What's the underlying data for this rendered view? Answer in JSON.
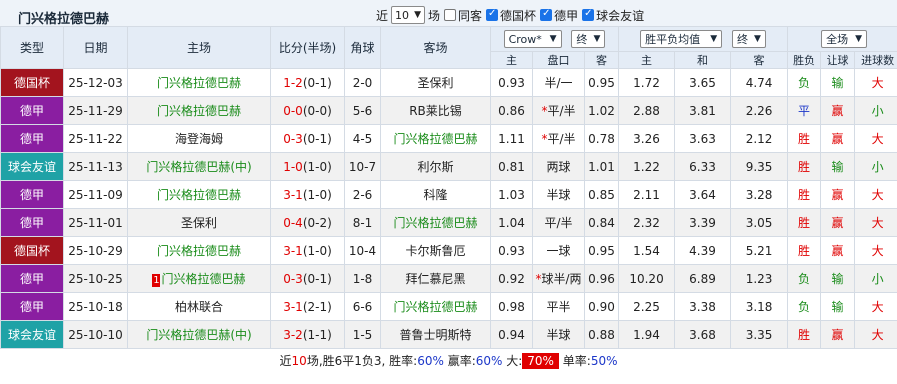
{
  "title": "门兴格拉德巴赫",
  "controls": {
    "prefix": "近",
    "count": "10",
    "suffix": "场",
    "filters": [
      {
        "label": "同客",
        "checked": false
      },
      {
        "label": "德国杯",
        "checked": true
      },
      {
        "label": "德甲",
        "checked": true
      },
      {
        "label": "球会友谊",
        "checked": true
      }
    ]
  },
  "headers": {
    "type": "类型",
    "date": "日期",
    "home": "主场",
    "score": "比分(半场)",
    "corner": "角球",
    "away": "客场",
    "company": "Crow*",
    "company_mode": "终",
    "odds_type": "胜平负均值",
    "odds_mode": "终",
    "scope": "全场",
    "result": "胜负",
    "handicap_result": "让球",
    "goals": "进球数",
    "sub_home": "主",
    "sub_line": "盘口",
    "sub_away": "客",
    "sub_win": "主",
    "sub_draw": "和",
    "sub_lose": "客"
  },
  "matches": [
    {
      "league": "德国杯",
      "league_color": "#a3141e",
      "date": "25-12-03",
      "home": "门兴格拉德巴赫",
      "score": "1-2",
      "half": "(0-1)",
      "corner": "2-0",
      "away": "圣保利",
      "h_odds": "0.93",
      "line": "半/一",
      "line_star": false,
      "a_odds": "0.95",
      "w": "1.72",
      "d": "3.65",
      "l": "4.74",
      "res": "负",
      "hres": "输",
      "ou": "大"
    },
    {
      "league": "德甲",
      "league_color": "#8a1ea1",
      "date": "25-11-29",
      "home": "门兴格拉德巴赫",
      "score": "0-0",
      "half": "(0-0)",
      "corner": "5-6",
      "away": "RB莱比锡",
      "h_odds": "0.86",
      "line": "平/半",
      "line_star": true,
      "a_odds": "1.02",
      "w": "2.88",
      "d": "3.81",
      "l": "2.26",
      "res": "平",
      "hres": "赢",
      "ou": "小"
    },
    {
      "league": "德甲",
      "league_color": "#8a1ea1",
      "date": "25-11-22",
      "home": "海登海姆",
      "score": "0-3",
      "half": "(0-1)",
      "corner": "4-5",
      "away": "门兴格拉德巴赫",
      "h_odds": "1.11",
      "line": "平/半",
      "line_star": true,
      "a_odds": "0.78",
      "w": "3.26",
      "d": "3.63",
      "l": "2.12",
      "res": "胜",
      "hres": "赢",
      "ou": "大"
    },
    {
      "league": "球会友谊",
      "league_color": "#1fa2a6",
      "date": "25-11-13",
      "home": "门兴格拉德巴赫(中)",
      "score": "1-0",
      "half": "(1-0)",
      "corner": "10-7",
      "away": "利尔斯",
      "h_odds": "0.81",
      "line": "两球",
      "line_star": false,
      "a_odds": "1.01",
      "w": "1.22",
      "d": "6.33",
      "l": "9.35",
      "res": "胜",
      "hres": "输",
      "ou": "小"
    },
    {
      "league": "德甲",
      "league_color": "#8a1ea1",
      "date": "25-11-09",
      "home": "门兴格拉德巴赫",
      "score": "3-1",
      "half": "(1-0)",
      "corner": "2-6",
      "away": "科隆",
      "h_odds": "1.03",
      "line": "半球",
      "line_star": false,
      "a_odds": "0.85",
      "w": "2.11",
      "d": "3.64",
      "l": "3.28",
      "res": "胜",
      "hres": "赢",
      "ou": "大"
    },
    {
      "league": "德甲",
      "league_color": "#8a1ea1",
      "date": "25-11-01",
      "home": "圣保利",
      "score": "0-4",
      "half": "(0-2)",
      "corner": "8-1",
      "away": "门兴格拉德巴赫",
      "h_odds": "1.04",
      "line": "平/半",
      "line_star": false,
      "a_odds": "0.84",
      "w": "2.32",
      "d": "3.39",
      "l": "3.05",
      "res": "胜",
      "hres": "赢",
      "ou": "大"
    },
    {
      "league": "德国杯",
      "league_color": "#a3141e",
      "date": "25-10-29",
      "home": "门兴格拉德巴赫",
      "score": "3-1",
      "half": "(1-0)",
      "corner": "10-4",
      "away": "卡尔斯鲁厄",
      "h_odds": "0.93",
      "line": "一球",
      "line_star": false,
      "a_odds": "0.95",
      "w": "1.54",
      "d": "4.39",
      "l": "5.21",
      "res": "胜",
      "hres": "赢",
      "ou": "大"
    },
    {
      "league": "德甲",
      "league_color": "#8a1ea1",
      "date": "25-10-25",
      "home": "门兴格拉德巴赫",
      "home_badge": "1",
      "score": "0-3",
      "half": "(0-1)",
      "corner": "1-8",
      "away": "拜仁慕尼黑",
      "h_odds": "0.92",
      "line": "球半/两",
      "line_star": true,
      "a_odds": "0.96",
      "w": "10.20",
      "d": "6.89",
      "l": "1.23",
      "res": "负",
      "hres": "输",
      "ou": "小"
    },
    {
      "league": "德甲",
      "league_color": "#8a1ea1",
      "date": "25-10-18",
      "home": "柏林联合",
      "score": "3-1",
      "half": "(2-1)",
      "corner": "6-6",
      "away": "门兴格拉德巴赫",
      "h_odds": "0.98",
      "line": "平半",
      "line_star": false,
      "a_odds": "0.90",
      "w": "2.25",
      "d": "3.38",
      "l": "3.18",
      "res": "负",
      "hres": "输",
      "ou": "大"
    },
    {
      "league": "球会友谊",
      "league_color": "#1fa2a6",
      "date": "25-10-10",
      "home": "门兴格拉德巴赫(中)",
      "score": "3-2",
      "half": "(1-1)",
      "corner": "1-5",
      "away": "普鲁士明斯特",
      "h_odds": "0.94",
      "line": "半球",
      "line_star": false,
      "a_odds": "0.88",
      "w": "1.94",
      "d": "3.68",
      "l": "3.35",
      "res": "胜",
      "hres": "赢",
      "ou": "大"
    }
  ],
  "summary": {
    "p1": "近",
    "n": "10",
    "p2": "场,胜6平1负3, 胜率:",
    "win_rate": "60%",
    "p3": " 赢率:",
    "handicap_rate": "60%",
    "p4": " 大:",
    "over_rate": "70%",
    "p5": " 单率:",
    "odd_rate": "50%"
  },
  "colors": {
    "win": "#e00000",
    "draw": "#1c37c9",
    "lose": "#1a8c1a",
    "cup": "#a3141e",
    "league": "#8a1ea1",
    "friendly": "#1fa2a6"
  }
}
